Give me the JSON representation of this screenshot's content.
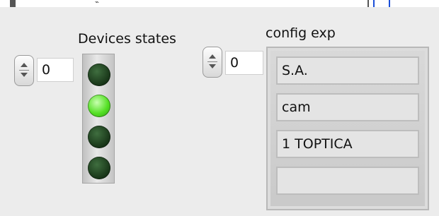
{
  "devices_states": {
    "label": "Devices states",
    "index_value": "0",
    "leds": [
      {
        "state": "off"
      },
      {
        "state": "on"
      },
      {
        "state": "off"
      },
      {
        "state": "off"
      }
    ],
    "colors": {
      "led_on": "#55e025",
      "led_off": "#173417"
    }
  },
  "config_exp": {
    "label": "config exp",
    "index_value": "0",
    "items": [
      "S.A.",
      "cam",
      "1 TOPTICA",
      ""
    ]
  }
}
